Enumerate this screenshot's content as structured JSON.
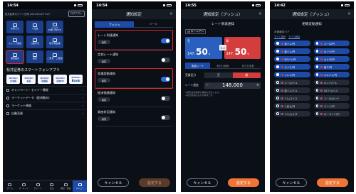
{
  "status_time": [
    "14:54",
    "14:54",
    "14:55",
    "14:42"
  ],
  "colors": {
    "highlight": "#e0232a",
    "primary_blue": "#1e4aa8",
    "orange": "#ef7436",
    "sell_blue": "#2a5fbf",
    "buy_red": "#d33d3d"
  },
  "phone1": {
    "header_left": "松井証券ログイン日時",
    "header_date": "2025/01/09 9:27",
    "logout_label": "ログアウト",
    "tiles": [
      {
        "label": "お知らせ",
        "icon": "mail-icon"
      },
      {
        "label": "入出金",
        "icon": "yen-icon"
      },
      {
        "label": "ヘルプ\nお問い合わせ",
        "icon": "help-icon"
      },
      {
        "label": "",
        "icon": ""
      },
      {
        "label": "スワップ振替",
        "icon": "swap-icon"
      },
      {
        "label": "口座状況",
        "icon": "account-icon"
      },
      {
        "label": "取引報告書",
        "icon": "report-icon"
      },
      {
        "label": "",
        "icon": ""
      },
      {
        "label": "通知設定",
        "icon": "bell-icon"
      },
      {
        "label": "設定",
        "icon": "gear-icon"
      },
      {
        "label": "ご意見・ご要望",
        "icon": "chat-icon"
      },
      {
        "label": "",
        "icon": ""
      }
    ],
    "site_title": "松井証券のスマートフォンアプリ",
    "app_icons": [
      {
        "top": "MATSUI",
        "bottom": "日本株",
        "big": false
      },
      {
        "top": "MATSUI",
        "bottom": "投信",
        "big": false
      },
      {
        "top": "MATSUI",
        "bottom": "米国株",
        "big": false
      },
      {
        "top": "MATSUI",
        "bottom": "先物OP",
        "big": false
      },
      {
        "top": "MATSUI",
        "bottom": "Bank",
        "big": true
      }
    ],
    "menu": [
      "キャンペーン・セミナー情報",
      "マーケットデータ（経済動向）",
      "マーケット情報",
      "自動売買"
    ],
    "tabs": [
      "ホーム",
      "マーケット",
      "チャート",
      "注文",
      "取引・照会",
      "メニュー"
    ]
  },
  "phone2": {
    "title": "通知設定",
    "close": "×",
    "seg_tabs": [
      "プッシュ",
      "メール"
    ],
    "rows": [
      {
        "name": "レート到達通知",
        "on": true,
        "hl": true
      },
      {
        "name": "定刻レート通知",
        "on": false,
        "hl": false
      },
      {
        "name": "相場変動通知",
        "on": true,
        "hl": true
      },
      {
        "name": "経済指標通知",
        "on": false,
        "hl": false
      },
      {
        "name": "資産状況通知",
        "on": false,
        "hl": false
      }
    ],
    "edit_label": "編集",
    "cancel": "キャンセル",
    "submit": "設定する"
  },
  "phone3": {
    "title": "通知設定（プッシュ）",
    "close": "×",
    "subtitle": "レート到達通知",
    "pair": "米ドル/円",
    "sell_label": "売",
    "buy_label": "買",
    "sell_big": "147",
    "sell_main": "50",
    "sell_pip": "4",
    "buy_big": "147",
    "buy_main": "50",
    "buy_pip": "6",
    "spread": "0.2",
    "type_tabs": [
      "指定レート",
      "前日比価格",
      "前日比変動"
    ],
    "side_label": "売買区分",
    "side_options": [
      "売",
      "買"
    ],
    "rate_label": "レート設定",
    "rate_value": "148.000",
    "minus": "−",
    "plus": "+",
    "notes": "※通知は受信時の相場を表示します。\n※前日終値は表示の時点です。",
    "cancel": "キャンセル",
    "submit": "設定する"
  },
  "phone4": {
    "title": "通知設定（プッシュ）",
    "close": "×",
    "subtitle": "相場変動通知",
    "section": "対象通貨ペア",
    "select_all": "すべて選択",
    "deselect_all": "すべて解除",
    "pairs": [
      {
        "label": "米ドル/円",
        "sel": true
      },
      {
        "label": "ユーロ/円",
        "sel": true
      },
      {
        "label": "豪ドル/円",
        "sel": true
      },
      {
        "label": "ポンド/円",
        "sel": true
      },
      {
        "label": "NZドル/円",
        "sel": true
      },
      {
        "label": "カナダ/円",
        "sel": true
      },
      {
        "label": "スイス/円",
        "sel": true
      },
      {
        "label": "南ア/円",
        "sel": true
      },
      {
        "label": "トルコ/円",
        "sel": true
      },
      {
        "label": "メキシコ/円",
        "sel": true
      },
      {
        "label": "ユーロ/ドル",
        "sel": false
      },
      {
        "label": "ポンド/ドル",
        "sel": false
      },
      {
        "label": "豪ドル/ドル",
        "sel": false
      },
      {
        "label": "NZドル/ドル",
        "sel": false
      },
      {
        "label": "ドル/スイス",
        "sel": false
      },
      {
        "label": "ユーロ/ポンド",
        "sel": false
      },
      {
        "label": "人民元/円",
        "sel": false
      },
      {
        "label": "ランド/円",
        "sel": false
      },
      {
        "label": "ドル/カナダ",
        "sel": false
      },
      {
        "label": "ポーランド/円",
        "sel": false
      }
    ],
    "cancel": "キャンセル",
    "submit": "設定する"
  }
}
